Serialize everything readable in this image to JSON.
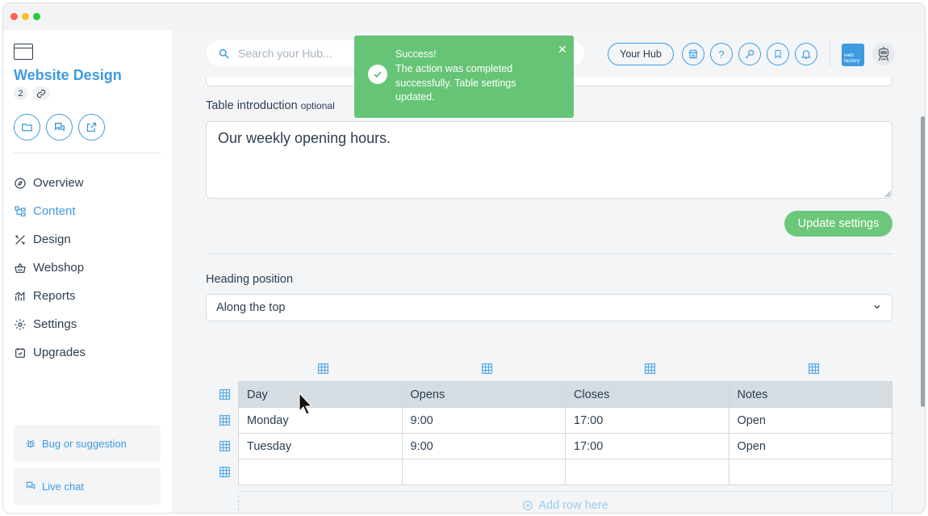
{
  "sidebar": {
    "site_title": "Website Design",
    "badge_count": "2",
    "nav": [
      {
        "label": "Overview",
        "icon": "compass-icon"
      },
      {
        "label": "Content",
        "icon": "sitemap-icon",
        "active": true
      },
      {
        "label": "Design",
        "icon": "brush-ruler-icon"
      },
      {
        "label": "Webshop",
        "icon": "basket-icon"
      },
      {
        "label": "Reports",
        "icon": "chart-icon"
      },
      {
        "label": "Settings",
        "icon": "gear-icon"
      },
      {
        "label": "Upgrades",
        "icon": "calendar-check-icon"
      }
    ],
    "bug_label": "Bug or suggestion",
    "chat_label": "Live chat"
  },
  "header": {
    "search_placeholder": "Search your Hub...",
    "hub_button": "Your Hub",
    "logo_text": "web factory"
  },
  "form": {
    "intro_label": "Table introduction",
    "intro_optional": "optional",
    "intro_value": "Our weekly opening hours.",
    "update_button": "Update settings",
    "heading_position_label": "Heading position",
    "heading_position_value": "Along the top"
  },
  "table": {
    "headers": [
      "Day",
      "Opens",
      "Closes",
      "Notes"
    ],
    "rows": [
      [
        "Monday",
        "9:00",
        "17:00",
        "Open"
      ],
      [
        "Tuesday",
        "9:00",
        "17:00",
        "Open"
      ],
      [
        "",
        "",
        "",
        ""
      ]
    ],
    "add_row_label": "Add row here"
  },
  "toast": {
    "title": "Success!",
    "message": "The action was completed successfully. Table settings updated."
  },
  "colors": {
    "accent": "#3d9be0",
    "success": "#66c476",
    "text": "#2c3e50"
  }
}
